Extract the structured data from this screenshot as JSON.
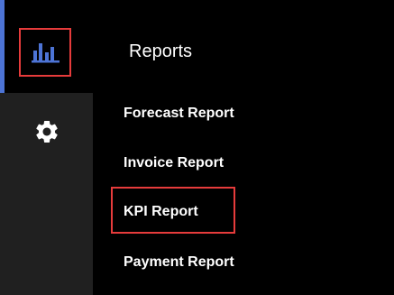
{
  "sidebar": {
    "items": [
      {
        "icon": "bar-chart-icon",
        "active": true
      },
      {
        "icon": "gear-icon",
        "active": false
      }
    ]
  },
  "reports_menu": {
    "title": "Reports",
    "items": [
      {
        "label": "Forecast Report"
      },
      {
        "label": "Invoice Report"
      },
      {
        "label": "KPI Report",
        "highlighted": true
      },
      {
        "label": "Payment Report"
      }
    ]
  },
  "colors": {
    "accent": "#4d74d6",
    "highlight": "#e63b3b",
    "background": "#000000",
    "rail": "#202020",
    "text": "#ffffff"
  }
}
